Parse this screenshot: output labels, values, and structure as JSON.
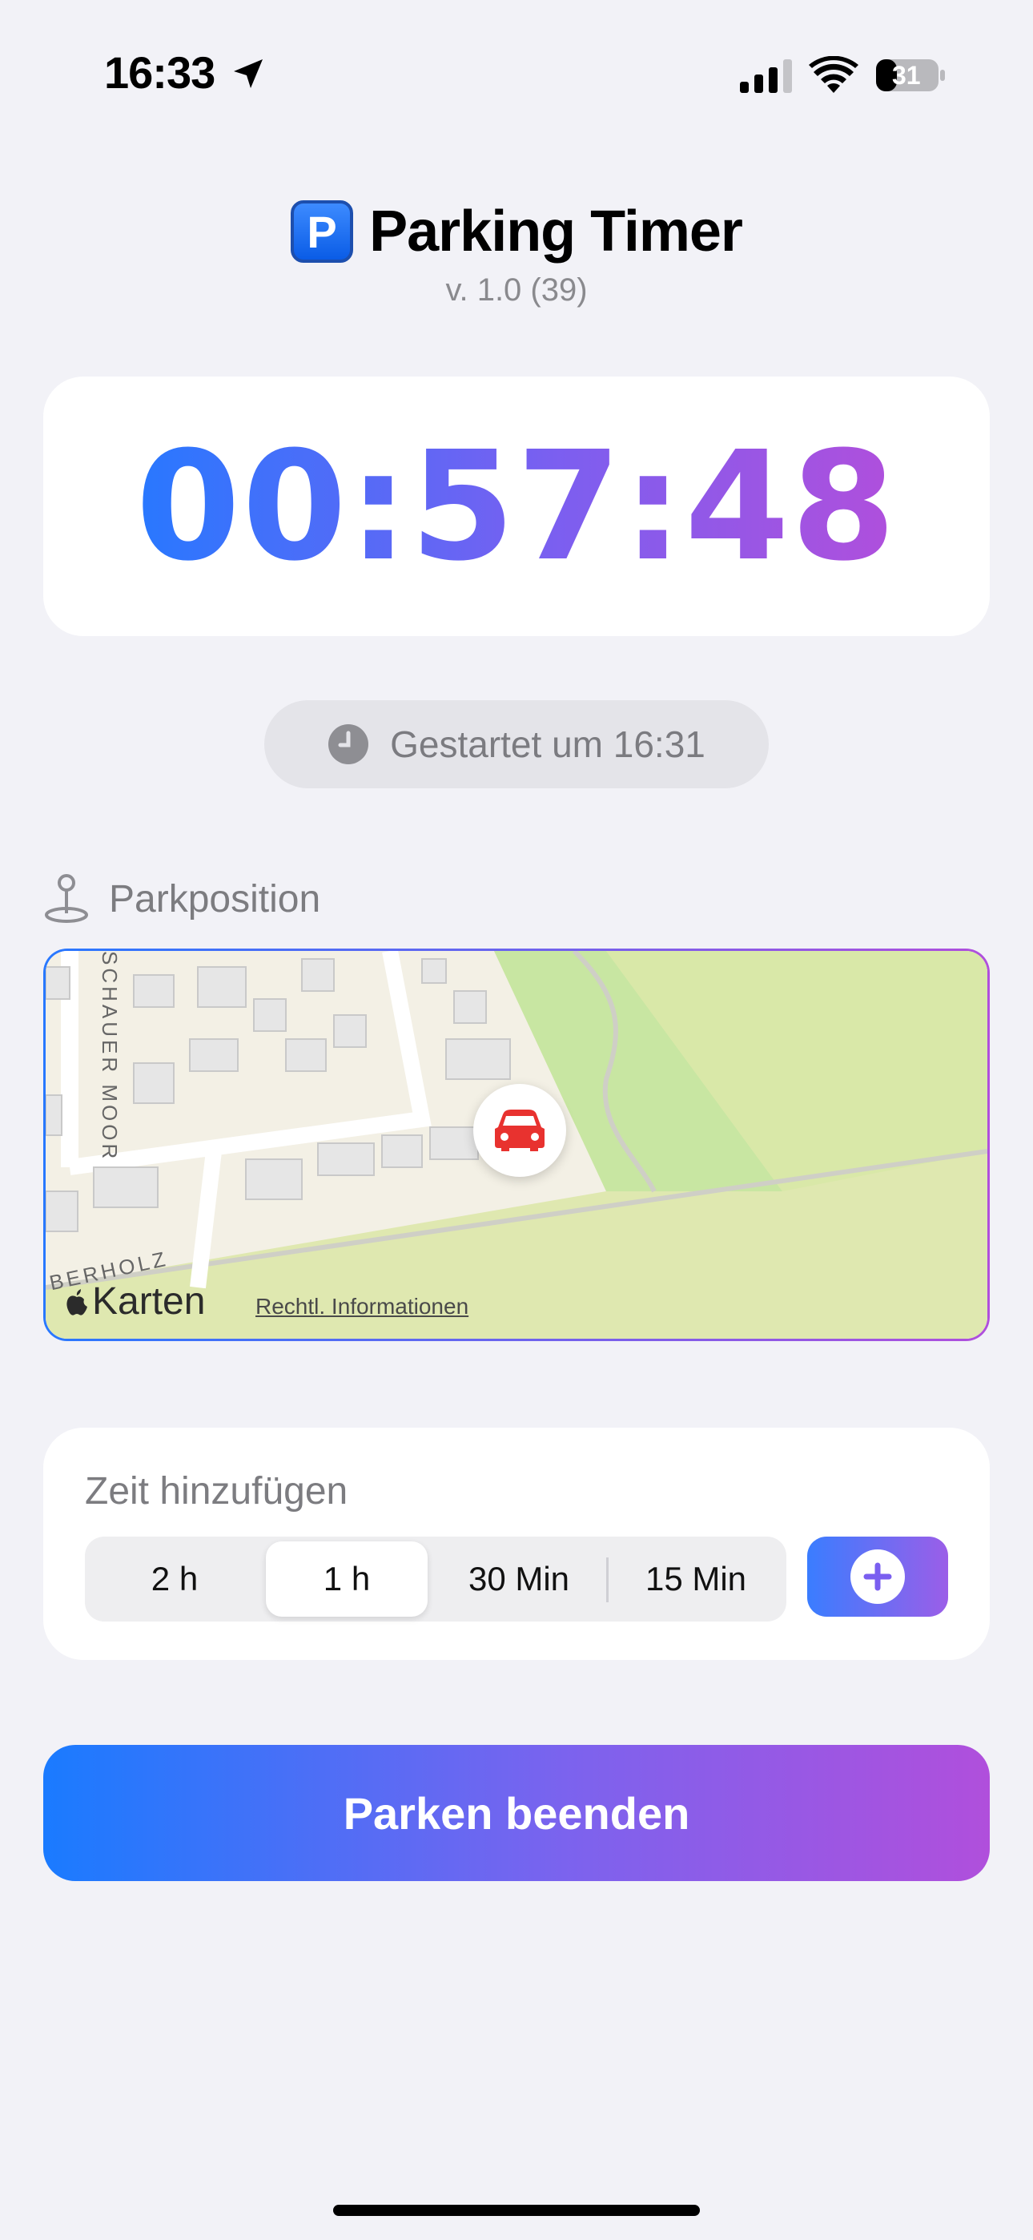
{
  "status_bar": {
    "time": "16:33",
    "battery": "31"
  },
  "header": {
    "badge": "P",
    "title": "Parking Timer",
    "version": "v. 1.0 (39)"
  },
  "timer": {
    "elapsed": "00:57:48"
  },
  "started": {
    "text": "Gestartet um 16:31"
  },
  "park_position": {
    "label": "Parkposition",
    "map": {
      "provider": "Karten",
      "legal_link": "Rechtl. Informationen",
      "street_labels": [
        "SCHAUER MOOR",
        "BERHOLZ"
      ],
      "marker_icon": "car-icon"
    }
  },
  "add_time": {
    "title": "Zeit hinzufügen",
    "options": [
      "2 h",
      "1 h",
      "30 Min",
      "15 Min"
    ],
    "selected": "1 h",
    "add_icon": "plus-icon"
  },
  "actions": {
    "end_parking": "Parken beenden"
  },
  "colors": {
    "accent_start": "#2878ff",
    "accent_end": "#b04fdc",
    "background": "#f2f2f7",
    "car_red": "#e8322f"
  }
}
